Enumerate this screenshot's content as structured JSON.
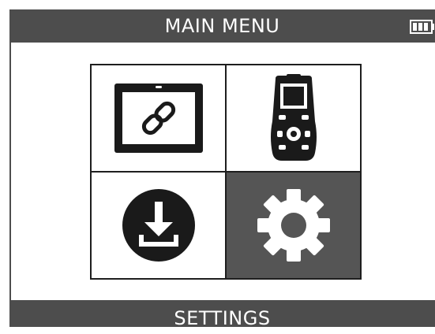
{
  "header": {
    "title": "MAIN MENU",
    "battery_icon": "battery-full-icon"
  },
  "menu": {
    "selected_index": 3,
    "tiles": [
      {
        "icon": "tablet-link-icon"
      },
      {
        "icon": "handheld-tool-icon"
      },
      {
        "icon": "download-icon"
      },
      {
        "icon": "gear-icon"
      }
    ]
  },
  "footer": {
    "label": "SETTINGS"
  },
  "colors": {
    "bar": "#4d4d4d",
    "selected_tile": "#555555",
    "icon": "#1a1a1a",
    "background": "#ffffff"
  }
}
